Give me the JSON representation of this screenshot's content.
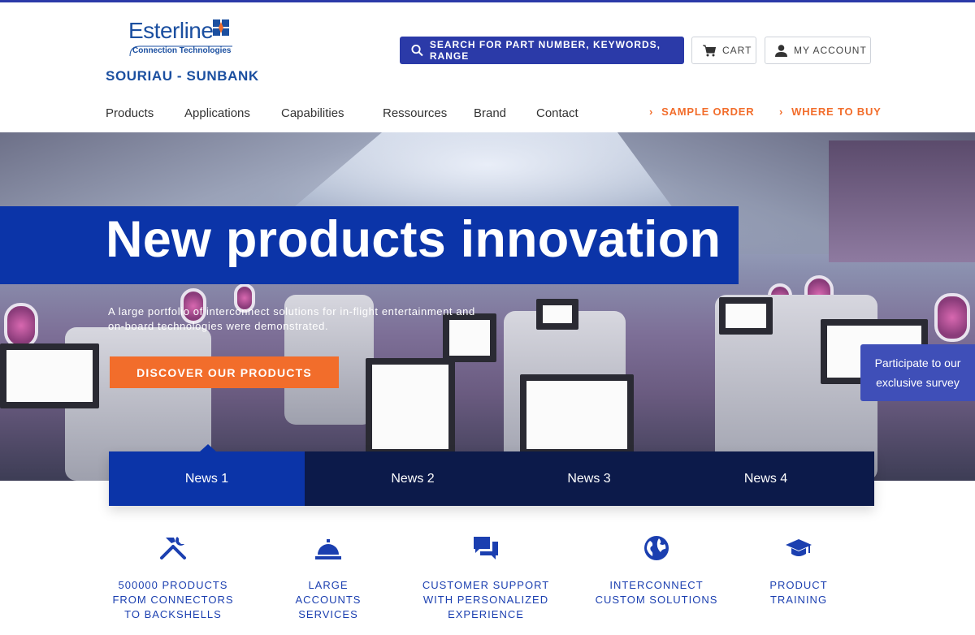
{
  "brand": {
    "logo_text": "Esterline",
    "logo_sub": "Connection Technologies",
    "name": "SOURIAU - SUNBANK"
  },
  "header": {
    "search_label": "SEARCH FOR PART NUMBER, KEYWORDS, RANGE",
    "cart_label": "CART",
    "account_label": "MY ACCOUNT"
  },
  "nav": {
    "items": [
      "Products",
      "Applications",
      "Capabilities",
      "Ressources",
      "Brand",
      "Contact"
    ],
    "sample_order": "SAMPLE ORDER",
    "where_to_buy": "WHERE TO BUY"
  },
  "hero": {
    "title": "New products innovation",
    "description": "A large portfolio of interconnect solutions for in-flight entertainment and on-board technologies were demonstrated.",
    "cta": "DISCOVER OUR PRODUCTS"
  },
  "survey": {
    "label": "Participate to our exclusive survey"
  },
  "news": {
    "tabs": [
      "News 1",
      "News 2",
      "News 3",
      "News 4"
    ],
    "active_index": 0
  },
  "features": [
    {
      "icon": "tools-icon",
      "label": "500000 PRODUCTS\nFROM CONNECTORS\nTO BACKSHELLS"
    },
    {
      "icon": "service-bell-icon",
      "label": "LARGE\nACCOUNTS\nSERVICES"
    },
    {
      "icon": "chat-icon",
      "label": "CUSTOMER SUPPORT\nWITH PERSONALIZED\nEXPERIENCE"
    },
    {
      "icon": "globe-icon",
      "label": "INTERCONNECT\nCUSTOM SOLUTIONS"
    },
    {
      "icon": "graduation-cap-icon",
      "label": "PRODUCT\nTRAINING"
    }
  ],
  "colors": {
    "primary": "#2b3aa8",
    "hero_band": "#0b34a8",
    "accent": "#f26d2b",
    "news_bg": "#0c1a4a"
  }
}
